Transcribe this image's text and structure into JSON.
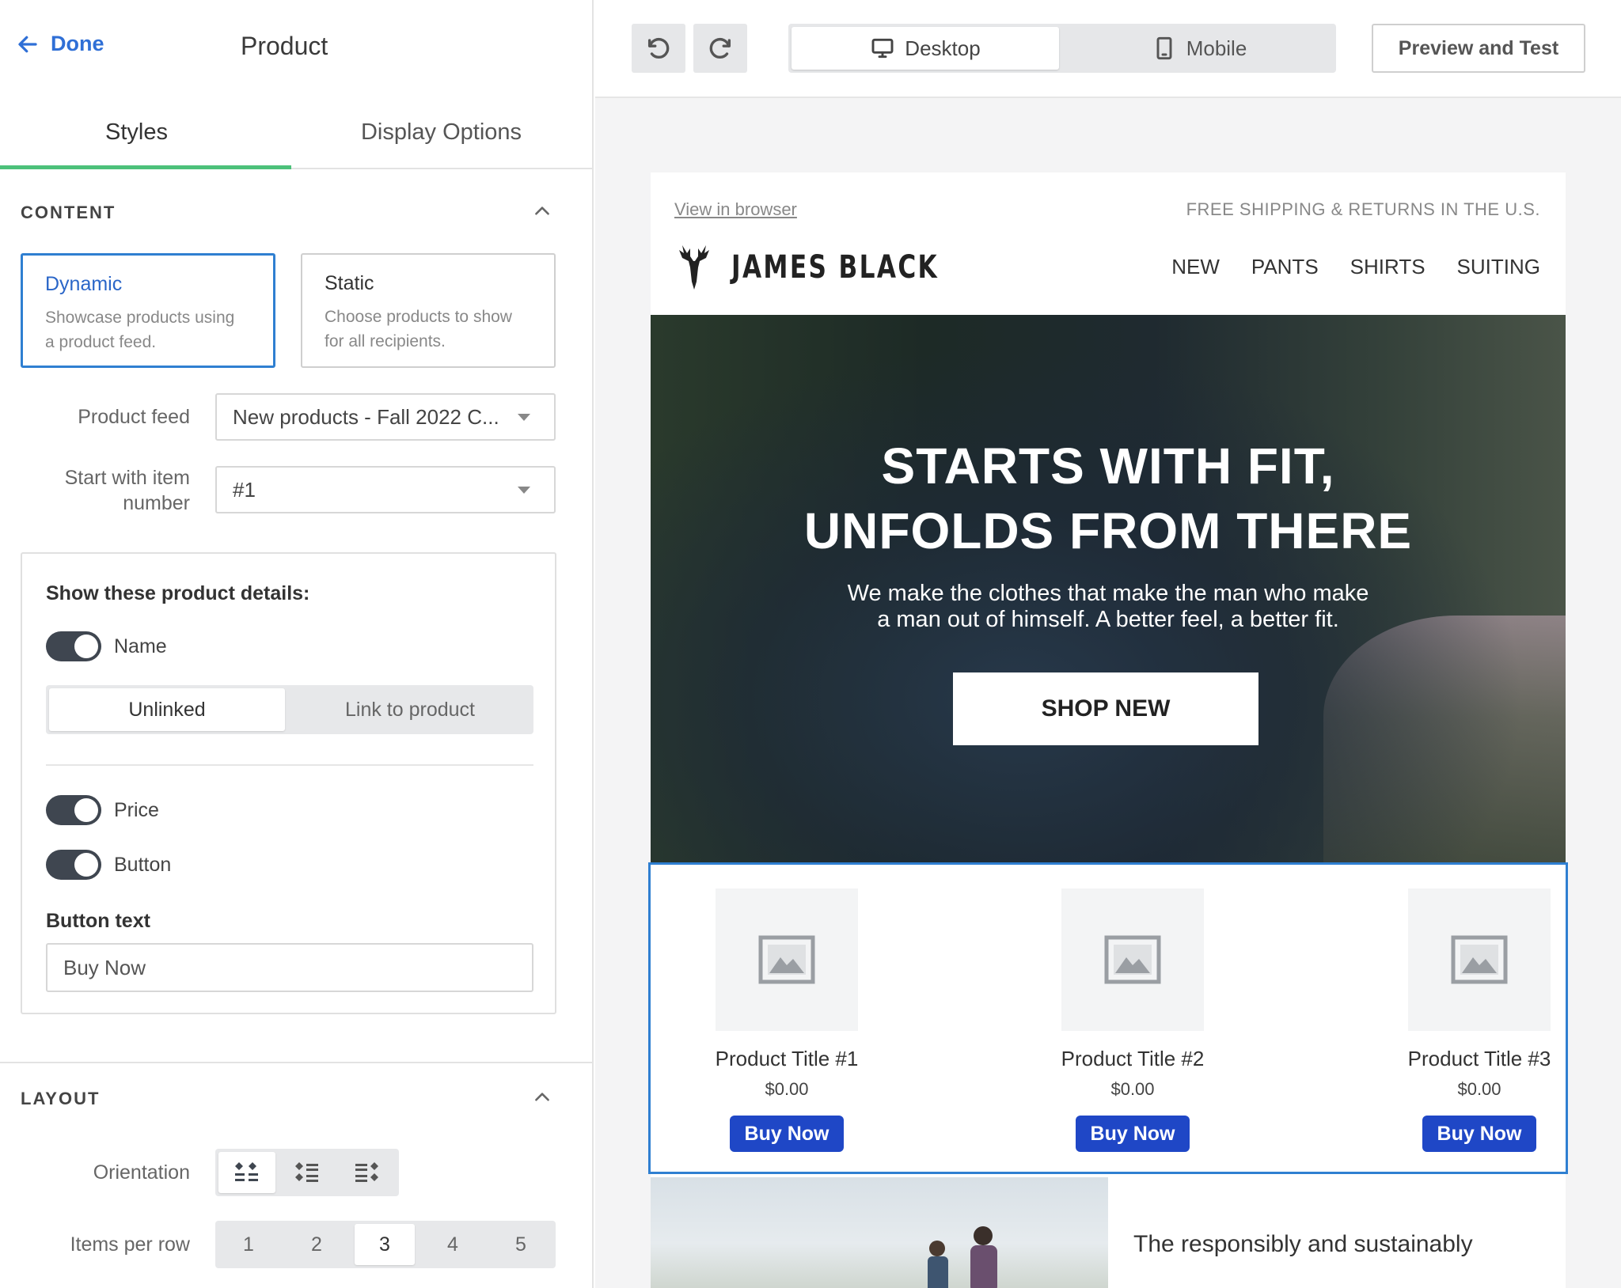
{
  "header": {
    "done_label": "Done",
    "title": "Product"
  },
  "tabs": [
    {
      "label": "Styles",
      "active": true
    },
    {
      "label": "Display Options",
      "active": false
    }
  ],
  "content_section": {
    "heading": "CONTENT",
    "choices": [
      {
        "title": "Dynamic",
        "desc_line1": "Showcase products using",
        "desc_line2": "a product feed.",
        "selected": true
      },
      {
        "title": "Static",
        "desc_line1": "Choose products to show",
        "desc_line2": "for all recipients.",
        "selected": false
      }
    ],
    "product_feed_label": "Product feed",
    "product_feed_value": "New products - Fall 2022 C...",
    "start_label_line1": "Start with item",
    "start_label_line2": "number",
    "start_value": "#1"
  },
  "details": {
    "title": "Show these product details:",
    "name_label": "Name",
    "link_options": [
      {
        "label": "Unlinked",
        "selected": true
      },
      {
        "label": "Link to product",
        "selected": false
      }
    ],
    "price_label": "Price",
    "button_label": "Button",
    "button_text_label": "Button text",
    "button_text_value": "Buy Now"
  },
  "layout_section": {
    "heading": "LAYOUT",
    "orientation_label": "Orientation",
    "items_per_row_label": "Items per row",
    "items_per_row": [
      "1",
      "2",
      "3",
      "4",
      "5"
    ],
    "items_per_row_selected": "3"
  },
  "toolbar": {
    "devices": [
      {
        "label": "Desktop",
        "selected": true
      },
      {
        "label": "Mobile",
        "selected": false
      }
    ],
    "preview_label": "Preview and Test"
  },
  "email": {
    "view_in_browser": "View in browser",
    "shipping_text": "FREE SHIPPING & RETURNS IN THE U.S.",
    "brand": "JAMES BLACK",
    "nav": [
      "NEW",
      "PANTS",
      "SHIRTS",
      "SUITING"
    ],
    "hero_title_line1": "STARTS WITH FIT,",
    "hero_title_line2": "UNFOLDS FROM THERE",
    "hero_body_line1": "We make the clothes that make the man who make",
    "hero_body_line2": "a man out of himself. A better feel, a better fit.",
    "hero_cta": "SHOP NEW",
    "products": [
      {
        "title": "Product Title #1",
        "price": "$0.00",
        "button": "Buy Now"
      },
      {
        "title": "Product Title #2",
        "price": "$0.00",
        "button": "Buy Now"
      },
      {
        "title": "Product Title #3",
        "price": "$0.00",
        "button": "Buy Now"
      }
    ],
    "below_text": "The responsibly and sustainably"
  },
  "colors": {
    "accent_blue": "#2f7fd1",
    "tab_green": "#4cc17a",
    "buy_button": "#1f47c6",
    "toggle_on": "#3f4650"
  }
}
